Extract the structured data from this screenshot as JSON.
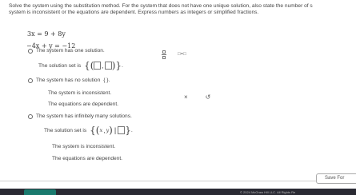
{
  "instructions": {
    "line1": "Solve the system using the substitution method. For the system that does not have one unique solution, also state the number of s",
    "line2": "system is inconsistent or the equations are dependent. Express numbers as integers or simplified fractions."
  },
  "system": {
    "eq1": "3x = 9 + 8y",
    "eq2": "−4x + y = −12"
  },
  "options": {
    "one_solution": "The system has one solution.",
    "solution_set_prefix": "The solution set is",
    "no_solution": "The system has no solution",
    "no_solution_set": "{ }.",
    "inconsistent_1": "The system is inconsistent.",
    "dependent_1": "The equations are dependent.",
    "infinite": "The system has infinitely many solutions.",
    "inf_set_prefix": "The solution set is",
    "inf_var_x": "x",
    "inf_var_y": "y",
    "inconsistent_2": "The system is inconsistent.",
    "dependent_2": "The equations are dependent."
  },
  "tools": {
    "eq_tool": "□=□",
    "clear": "×",
    "undo": "↺"
  },
  "footer": {
    "save_label": "Save For",
    "copyright": "© 2024 McGraw Hill LLC. All Rights Re"
  }
}
